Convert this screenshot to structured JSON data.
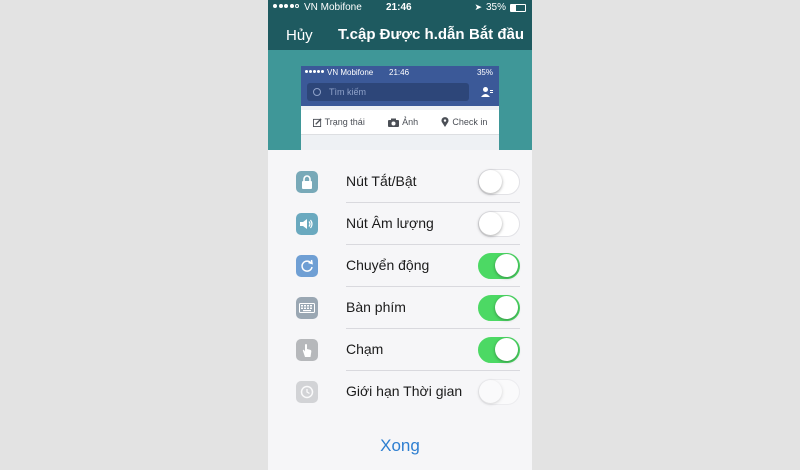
{
  "status_bar": {
    "carrier": "VN Mobifone",
    "time": "21:46",
    "battery": "35%"
  },
  "nav": {
    "cancel": "Hủy",
    "title": "T.cập Được h.dẫn",
    "start": "Bắt đầu"
  },
  "preview": {
    "carrier": "VN Mobifone",
    "time": "21:46",
    "battery": "35%",
    "search_placeholder": "Tìm kiếm",
    "actions": [
      {
        "label": "Trạng thái",
        "icon": "edit-icon"
      },
      {
        "label": "Ảnh",
        "icon": "camera-icon"
      },
      {
        "label": "Check in",
        "icon": "location-pin-icon"
      }
    ]
  },
  "options": [
    {
      "label": "Nút Tắt/Bật",
      "icon": "lock-icon",
      "on": false,
      "enabled": true,
      "color": "#78a9b8"
    },
    {
      "label": "Nút Âm lượng",
      "icon": "speaker-icon",
      "on": false,
      "enabled": true,
      "color": "#6aa9bf"
    },
    {
      "label": "Chuyển động",
      "icon": "rotate-icon",
      "on": true,
      "enabled": true,
      "color": "#6f9fd4"
    },
    {
      "label": "Bàn phím",
      "icon": "keyboard-icon",
      "on": true,
      "enabled": true,
      "color": "#9aa7b3"
    },
    {
      "label": "Chạm",
      "icon": "touch-hand-icon",
      "on": true,
      "enabled": true,
      "color": "#b6b8bb"
    },
    {
      "label": "Giới hạn Thời gian",
      "icon": "clock-icon",
      "on": false,
      "enabled": false,
      "color": "#a8aaad"
    }
  ],
  "done_label": "Xong",
  "colors": {
    "toggle_on": "#4cd964",
    "nav_bg": "#1e5a60",
    "done": "#2e7fd1"
  }
}
